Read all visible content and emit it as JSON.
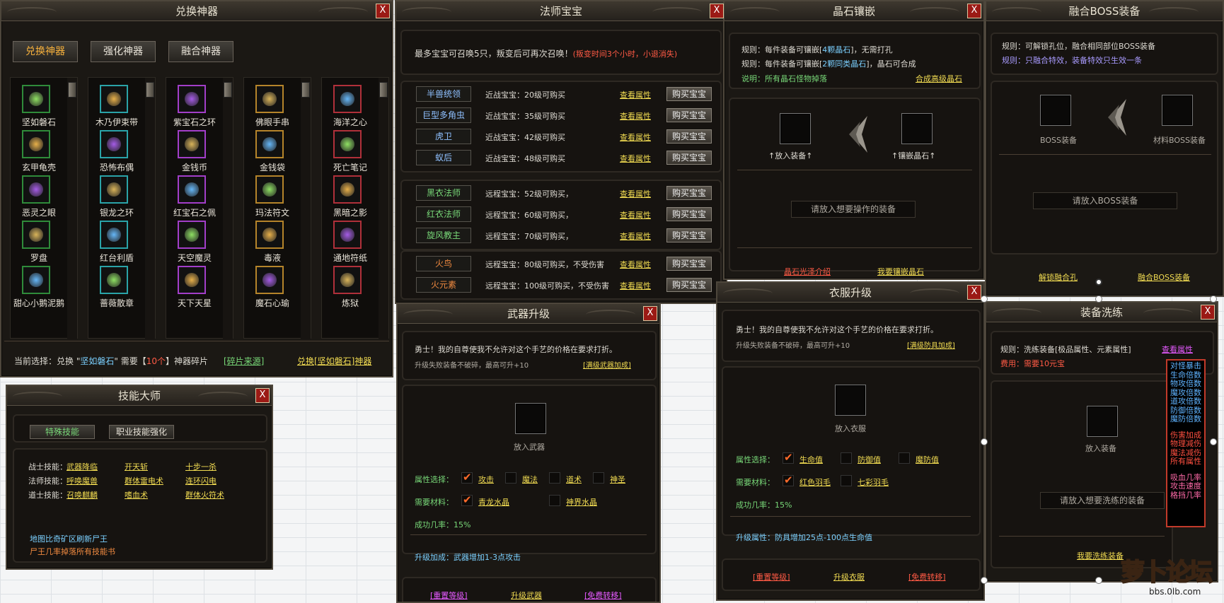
{
  "exchange": {
    "title": "兑换神器",
    "tabs": [
      "兑换神器",
      "强化神器",
      "融合神器"
    ],
    "columns": [
      [
        "坚如磐石",
        "玄甲龟壳",
        "恶灵之眼",
        "罗盘",
        "甜心小鹅泥鹅"
      ],
      [
        "木乃伊束带",
        "恐怖布偶",
        "银龙之环",
        "红台利盾",
        "蔷薇散章"
      ],
      [
        "紫宝石之环",
        "金钱币",
        "红宝石之佩",
        "天空魔灵",
        "天下天星"
      ],
      [
        "佛眼手串",
        "金钱袋",
        "玛法符文",
        "毒液",
        "魔石心瑜"
      ],
      [
        "海洋之心",
        "死亡笔记",
        "黑暗之影",
        "通地符纸",
        "炼狱"
      ]
    ],
    "status": {
      "prefix": "当前选择：兑换 \"",
      "item": "坚如磐石",
      "mid": "\" 需要【",
      "count": "10个",
      "suffix": "】神器碎片",
      "link1": "[碎片来源]",
      "link2": "兑换[坚如磐石]神器"
    }
  },
  "pet": {
    "title": "法师宝宝",
    "note": "最多宝宝可召唤5只，叛变后可再次召唤！",
    "note_red": "(叛变时间3个小时，小退消失)",
    "rows": [
      {
        "name": "半兽统领",
        "desc": "近战宝宝：20级可购买",
        "c": ""
      },
      {
        "name": "巨型多角虫",
        "desc": "近战宝宝：35级可购买",
        "c": ""
      },
      {
        "name": "虎卫",
        "desc": "近战宝宝：42级可购买",
        "c": ""
      },
      {
        "name": "蚁后",
        "desc": "近战宝宝：48级可购买",
        "c": ""
      },
      {
        "name": "黑衣法师",
        "desc": "远程宝宝：52级可购买，",
        "c": "g"
      },
      {
        "name": "红衣法师",
        "desc": "远程宝宝：60级可购买，",
        "c": "g"
      },
      {
        "name": "旋风教主",
        "desc": "远程宝宝：70级可购买，",
        "c": "g"
      },
      {
        "name": "火鸟",
        "desc": "远程宝宝：80级可购买，不受伤害",
        "c": "o"
      },
      {
        "name": "火元素",
        "desc": "远程宝宝：100级可购买，不受伤害",
        "c": "o"
      }
    ],
    "view": "查看属性",
    "buy": "购买宝宝"
  },
  "gem": {
    "title": "晶石镶嵌",
    "rule1a": "规则：每件装备可镶嵌[",
    "rule1b": "4颗晶石",
    "rule1c": "]，无需打孔",
    "rule2a": "规则：每件装备可镶嵌[",
    "rule2b": "2颗同类晶石",
    "rule2c": "]，晶石可合成",
    "note": "说明：所有晶石怪物掉落",
    "link_compose": "合成高级晶石",
    "slot1": "↑放入装备↑",
    "slot2": "↑镶嵌晶石↑",
    "placeholder": "请放入想要操作的装备",
    "link_intro": "晶石光泽介绍",
    "link_inlay": "我要镶嵌晶石"
  },
  "boss": {
    "title": "融合BOSS装备",
    "rule1": "规则：可解锁孔位，融合相同部位BOSS装备",
    "rule2": "规则：只融合特效，装备特效只生效一条",
    "slot1": "BOSS装备",
    "slot2": "材料BOSS装备",
    "placeholder": "请放入BOSS装备",
    "link1": "解锁融合孔",
    "link2": "融合BOSS装备"
  },
  "weapon": {
    "title": "武器升级",
    "line1": "勇士！我的自尊使我不允许对这个手艺的价格在要求打折。",
    "line2": "升级失败装备不破碎，最高可升+10",
    "link_max": "[满级武器加成]",
    "slot": "放入武器",
    "attr_label": "属性选择：",
    "attrs": [
      "攻击",
      "魔法",
      "道术",
      "神圣"
    ],
    "mat_label": "需要材料：",
    "mats": [
      "青龙水晶",
      "神界水晶"
    ],
    "rate": "成功几率：15%",
    "bonus": "升级加成：武器增加1-3点攻击",
    "btn1": "[重置等级]",
    "btn2": "升级武器",
    "btn3": "[免费转移]"
  },
  "armor": {
    "title": "衣服升级",
    "line1": "勇士！我的自尊使我不允许对这个手艺的价格在要求打折。",
    "line2": "升级失败装备不破碎，最高可升+10",
    "link_max": "[满级防具加成]",
    "slot": "放入衣服",
    "attr_label": "属性选择：",
    "attrs": [
      "生命值",
      "防御值",
      "魔防值"
    ],
    "mat_label": "需要材料：",
    "mats": [
      "红色羽毛",
      "七彩羽毛"
    ],
    "rate": "成功几率：15%",
    "bonus": "升级属性：防具增加25点-100点生命值",
    "btn1": "[重置等级]",
    "btn2": "升级衣服",
    "btn3": "[免费转移]"
  },
  "skill": {
    "title": "技能大师",
    "tab1": "特殊技能",
    "tab2": "职业技能强化",
    "rows": [
      {
        "label": "战士技能：",
        "s": [
          "武器降临",
          "开天斩",
          "十步一杀"
        ]
      },
      {
        "label": "法师技能：",
        "s": [
          "呼唤魔兽",
          "群体雷电术",
          "连环闪电"
        ]
      },
      {
        "label": "道士技能：",
        "s": [
          "召唤麒麟",
          "嗜血术",
          "群体火符术"
        ]
      }
    ],
    "note1": "地图比奇矿区刷新尸王",
    "note2": "尸王几率掉落所有技能书"
  },
  "refine": {
    "title": "装备洗练",
    "rule": "规则：洗练装备[极品属性、元素属性]",
    "link_view": "查看属性",
    "cost": "费用：需要10元宝",
    "slot": "放入装备",
    "placeholder": "请放入想要洗练的装备",
    "link": "我要洗练装备",
    "list_blue": [
      "对怪暴击",
      "生命倍数",
      "物攻倍数",
      "魔攻倍数",
      "道攻倍数",
      "防御倍数",
      "魔防倍数"
    ],
    "list_red": [
      "伤害加成",
      "物理减伤",
      "魔法减伤",
      "所有属性"
    ],
    "list_pink": [
      "吸血几率",
      "攻击速度",
      "格挡几率"
    ]
  },
  "watermark": {
    "text": "萝卜论坛",
    "sub": "bbs.0lb.com"
  },
  "close_glyph": "X"
}
